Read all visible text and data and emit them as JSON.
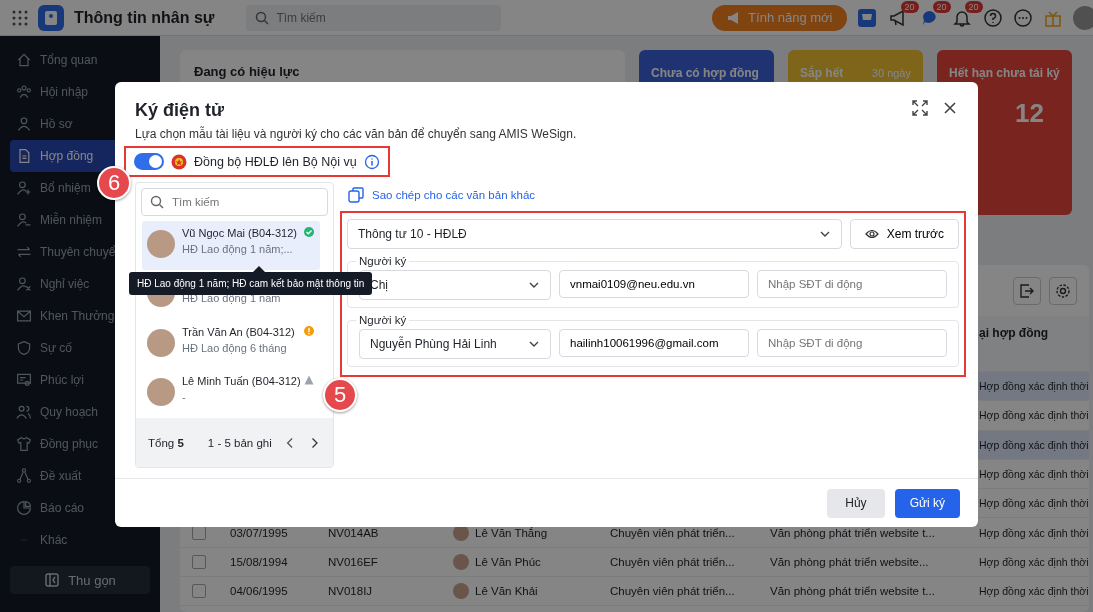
{
  "topbar": {
    "title": "Thông tin nhân sự",
    "search": {
      "placeholder": "Tìm kiếm"
    },
    "new_features_button": "Tính năng mới",
    "badges": [
      "20",
      "20",
      "20"
    ]
  },
  "sidebar": {
    "items": [
      {
        "label": "Tổng quan",
        "selected": false
      },
      {
        "label": "Hội nhập",
        "selected": false
      },
      {
        "label": "Hồ sơ",
        "selected": false
      },
      {
        "label": "Hợp đồng",
        "selected": true
      },
      {
        "label": "Bổ nhiệm",
        "selected": false
      },
      {
        "label": "Miễn nhiệm",
        "selected": false
      },
      {
        "label": "Thuyên chuyể",
        "selected": false
      },
      {
        "label": "Nghỉ việc",
        "selected": false
      },
      {
        "label": "Khen Thưởng",
        "selected": false
      },
      {
        "label": "Sự cố",
        "selected": false
      },
      {
        "label": "Phúc lợi",
        "selected": false
      },
      {
        "label": "Quy hoạch",
        "selected": false
      },
      {
        "label": "Đồng phục",
        "selected": false
      },
      {
        "label": "Đề xuất",
        "selected": false
      },
      {
        "label": "Báo cáo",
        "selected": false
      },
      {
        "label": "Khác",
        "selected": false
      }
    ],
    "collapse_button": "Thu gọn"
  },
  "summary": {
    "active_card": {
      "title": "Đang có hiệu lực"
    },
    "tiles": [
      {
        "title": "Chưa có hợp đồng",
        "kind": "missing"
      },
      {
        "title": "Sắp hết",
        "filter": "30 ngày",
        "kind": "expiring"
      },
      {
        "title": "Hết hạn chưa tái ký",
        "count": "12",
        "kind": "expired"
      }
    ]
  },
  "table": {
    "last_column_header": "ại hợp đồng",
    "rows": [
      {
        "selected": true,
        "cells": [
          "Hợp đồng xác định thời"
        ]
      },
      {
        "selected": false,
        "cells": [
          "Hợp đồng xác định thời"
        ]
      },
      {
        "selected": true,
        "cells": [
          "Hợp đồng xác định thời"
        ]
      },
      {
        "selected": false,
        "cells": [
          "Hợp đồng xác định thời"
        ]
      },
      {
        "selected": false,
        "cells": [
          "Hợp đồng xác định thời"
        ]
      },
      {
        "selected": false,
        "checked": false,
        "cells": [
          "03/07/1995",
          "NV014AB",
          "Lê Văn Thắng",
          "Chuyên viên phát triển...",
          "Văn phòng phát triển website t...",
          "Hợp đồng xác định thời"
        ]
      },
      {
        "selected": false,
        "checked": false,
        "cells": [
          "15/08/1994",
          "NV016EF",
          "Lê Văn Phúc",
          "Chuyên viên phát triển...",
          "Văn phòng phát triển website...",
          "Hợp đồng xác định thời"
        ]
      },
      {
        "selected": false,
        "checked": false,
        "cells": [
          "04/06/1995",
          "NV018IJ",
          "Lê Văn Khải",
          "Chuyên viên phát triển...",
          "Văn phòng phát triển website t...",
          "Hợp đồng xác định thời"
        ]
      }
    ]
  },
  "dialog": {
    "title": "Ký điện tử",
    "subtitle": "Lựa chọn mẫu tài liệu và người ký cho các văn bản để chuyển sang AMIS WeSign.",
    "sync_toggle": {
      "on": true,
      "label": "Đồng bộ HĐLĐ lên Bộ Nội vụ",
      "callout": "6"
    },
    "employee_search": {
      "placeholder": "Tìm kiếm"
    },
    "employees": [
      {
        "name": "Vũ Ngọc Mai (B04-312)",
        "contract": "HĐ Lao động 1 năm;...",
        "kind": "done",
        "selected": true
      },
      {
        "contract": "HĐ Lao động 1 năm",
        "selected": false
      },
      {
        "name": "Trần Văn An (B04-312)",
        "contract": "HĐ Lao động 6 tháng",
        "kind": "warning",
        "selected": false
      },
      {
        "name": "Lê Minh Tuấn (B04-312)",
        "contract": "-",
        "kind": "pending",
        "selected": false
      }
    ],
    "tooltip": "HĐ Lao động 1 năm; HĐ cam kết bảo mật thông tin",
    "pager": {
      "total_label": "Tổng",
      "total": "5",
      "range": "1 - 5 bản ghi"
    },
    "copy_link": "Sao chép cho các văn bản khác",
    "signing_panel": {
      "callout": "5",
      "template": "Thông tư 10 - HĐLĐ",
      "preview_button": "Xem trước",
      "signers": [
        {
          "legend": "Người ký",
          "name": "Chị",
          "email": "vnmai0109@neu.edu.vn",
          "phone_placeholder": "Nhập SĐT di động"
        },
        {
          "legend": "Người ký",
          "name": "Nguyễn Phùng Hải Linh",
          "email": "hailinh10061996@gmail.com",
          "phone_placeholder": "Nhập SĐT di động"
        }
      ]
    },
    "buttons": {
      "cancel": "Hủy",
      "submit": "Gửi ký"
    }
  }
}
